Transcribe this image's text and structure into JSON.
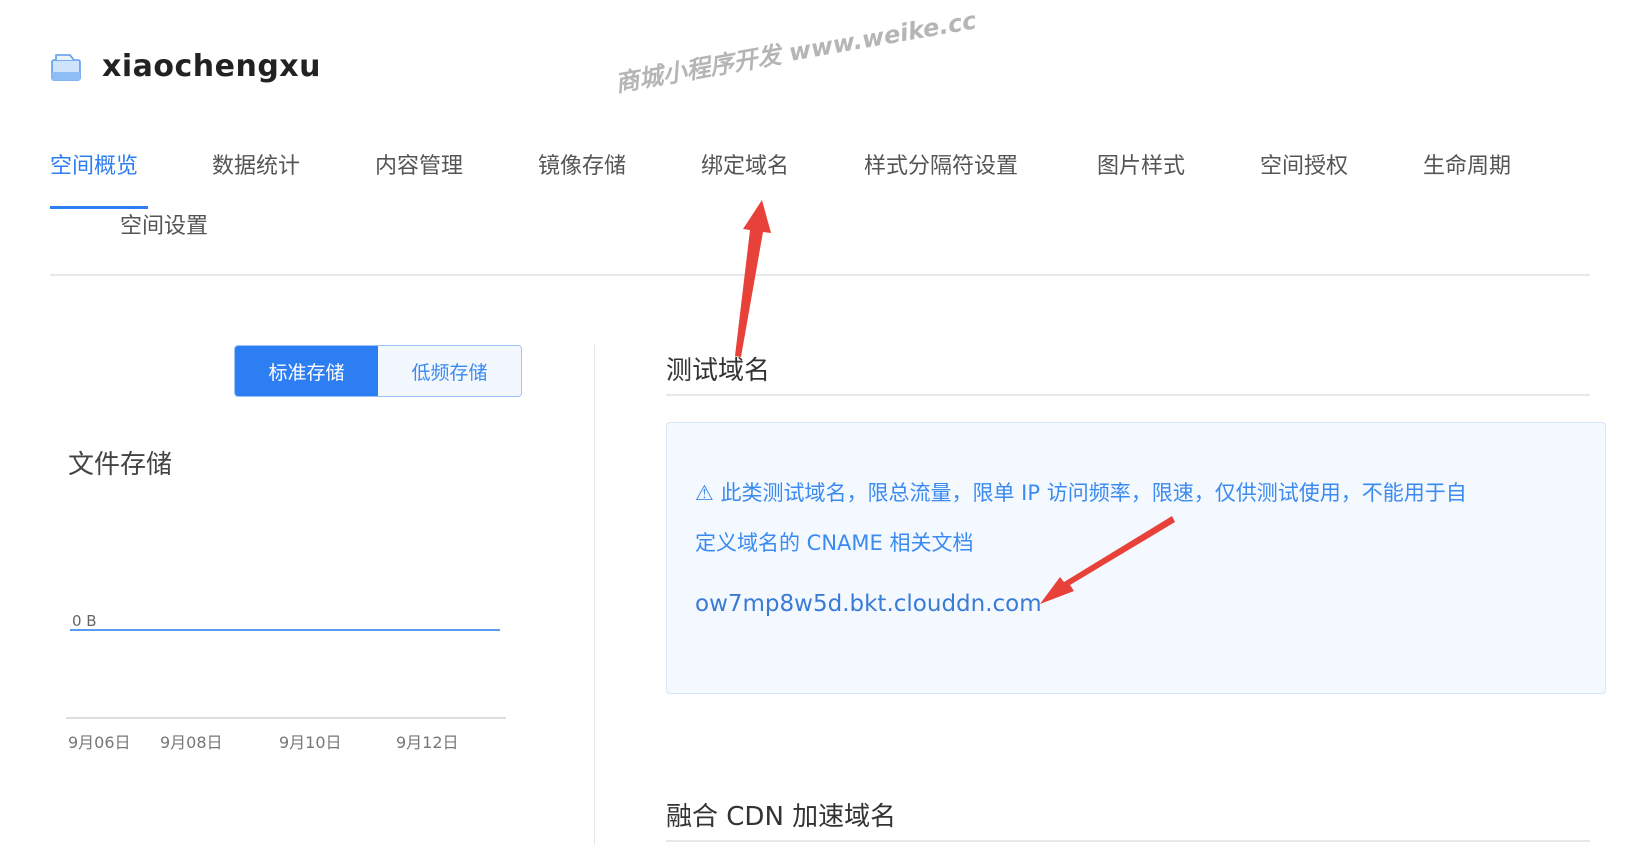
{
  "header": {
    "bucket_name": "xiaochengxu",
    "icon": "bucket-icon"
  },
  "watermark": {
    "text": "商城小程序开发 www.weike.cc"
  },
  "tabs": [
    {
      "label": "空间概览",
      "active": true
    },
    {
      "label": "数据统计"
    },
    {
      "label": "内容管理"
    },
    {
      "label": "镜像存储"
    },
    {
      "label": "绑定域名"
    },
    {
      "label": "样式分隔符设置"
    },
    {
      "label": "图片样式"
    },
    {
      "label": "空间授权"
    },
    {
      "label": "生命周期"
    },
    {
      "label": "空间设置"
    }
  ],
  "storage_toggle": {
    "standard": "标准存储",
    "low_freq": "低频存储",
    "selected": "standard"
  },
  "file_storage": {
    "title": "文件存储"
  },
  "chart_data": {
    "type": "line",
    "x": [
      "9月06日",
      "9月08日",
      "9月10日",
      "9月12日"
    ],
    "series": [
      {
        "values": [
          0,
          0,
          0,
          0
        ]
      }
    ],
    "y_tick_labels": [
      "0 B"
    ],
    "ylim": [
      0,
      1
    ]
  },
  "test_domain": {
    "title": "测试域名",
    "notice_line1": "⚠ 此类测试域名，限总流量，限单 IP 访问频率，限速，仅供测试使用，不能用于自",
    "notice_line2": "定义域名的 CNAME 相关文档",
    "domain": "ow7mp8w5d.bkt.clouddn.com"
  },
  "cdn_domain": {
    "title": "融合 CDN 加速域名"
  },
  "colors": {
    "accent": "#2e7ef3",
    "arrow": "#e8413a"
  }
}
